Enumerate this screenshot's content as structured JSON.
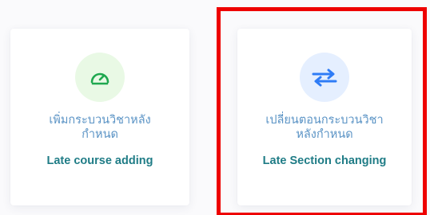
{
  "cards": [
    {
      "icon": "speedometer-icon",
      "title_th_line1": "เพิ่มกระบวนวิชาหลัง",
      "title_th_line2": "กำหนด",
      "title_en": "Late course adding",
      "icon_color": "#1fa84f",
      "icon_bg": "#e9f9e5"
    },
    {
      "icon": "swap-arrows-icon",
      "title_th_line1": "เปลี่ยนตอนกระบวนวิชา",
      "title_th_line2": "หลังกำหนด",
      "title_en": "Late Section changing",
      "icon_color": "#2f7cf6",
      "icon_bg": "#e5efff"
    }
  ],
  "colors": {
    "thai_text": "#5a93c5",
    "english_text": "#1f7c86",
    "highlight_border": "#ee0000"
  }
}
